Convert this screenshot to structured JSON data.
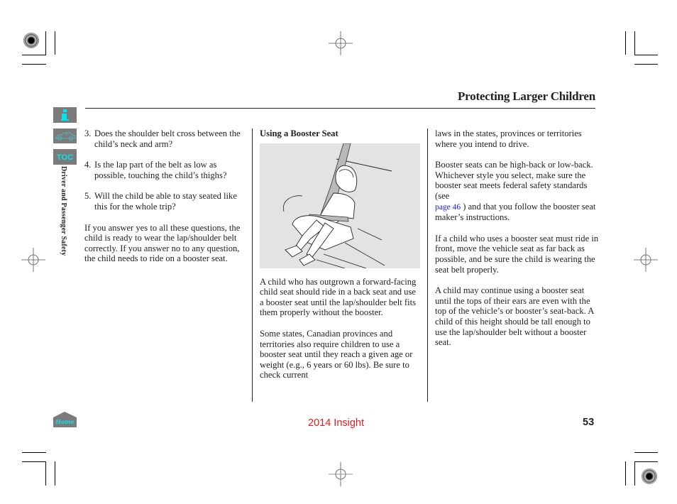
{
  "header": {
    "title": "Protecting Larger Children"
  },
  "sidebar": {
    "info_label": "i",
    "toc_label": "TOC",
    "home_label": "Home",
    "section_label": "Driver and Passenger Safety",
    "accent_color": "#00e5ee",
    "button_color": "#7b7b7b"
  },
  "column1": {
    "list": [
      {
        "num": "3.",
        "text": "Does the shoulder belt cross between the child’s neck and arm?"
      },
      {
        "num": "4.",
        "text": "Is the lap part of the belt as low as possible, touching the child’s thighs?"
      },
      {
        "num": "5.",
        "text": "Will the child be able to stay seated like this for the whole trip?"
      }
    ],
    "paragraph": "If you answer yes to all these questions, the child is ready to wear the lap/shoulder belt correctly. If you answer no to any question, the child needs to ride on a booster seat."
  },
  "column2": {
    "heading": "Using a Booster Seat",
    "figure_alt": "Child seated on a booster seat wearing lap/shoulder belt",
    "paragraphs": [
      "A child who has outgrown a forward-facing child seat should ride in a back seat and use a booster seat until the lap/shoulder belt fits them properly without the booster.",
      "Some states, Canadian provinces and territories also require children to use a booster seat until they reach a given age or weight (e.g., 6 years or 60 lbs). Be sure to check current"
    ]
  },
  "column3": {
    "p1": "laws in the states, provinces or territories where you intend to drive.",
    "p2_before": "Booster seats can be high-back or low-back. Whichever style you select, make sure the booster seat meets federal safety standards (see",
    "p2_link": "page 46",
    "p2_after": ") and that you follow the booster  seat maker’s instructions.",
    "p3": "If a child who uses a booster seat must ride in front, move the vehicle seat as far back as possible, and be sure the child is wearing the seat belt properly.",
    "p4": "A child may continue using a booster seat until the tops of their ears are even with the top of the vehicle’s or booster’s seat-back. A child of this height should be tall enough to use the lap/shoulder belt without a booster seat."
  },
  "footer": {
    "model": "2014 Insight",
    "page_number": "53",
    "model_color": "#e31b1b"
  }
}
